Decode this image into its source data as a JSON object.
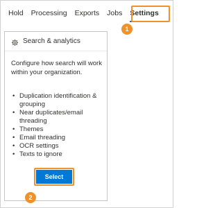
{
  "tabs": [
    {
      "label": "Hold",
      "selected": false
    },
    {
      "label": "Processing",
      "selected": false
    },
    {
      "label": "Exports",
      "selected": false
    },
    {
      "label": "Jobs",
      "selected": false
    },
    {
      "label": "Settings",
      "selected": true
    }
  ],
  "callouts": {
    "first": "1",
    "second": "2"
  },
  "card": {
    "icon": "gear-icon",
    "title": "Search & analytics",
    "description": "Configure how search will work within your organization.",
    "features": [
      "Duplication identification & grouping",
      "Near duplicates/email threading",
      "Themes",
      "Email threading",
      "OCR settings",
      "Texts to ignore"
    ],
    "button_label": "Select"
  },
  "colors": {
    "accent": "#0078d4",
    "callout": "#f0922b"
  }
}
